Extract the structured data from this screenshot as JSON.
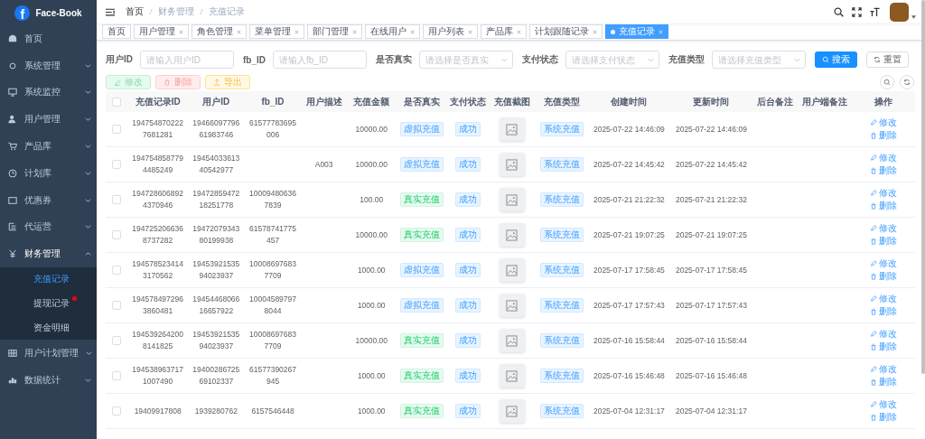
{
  "sidebar": {
    "logo_mark": "f",
    "title": "Face-Book",
    "items": [
      {
        "label": "首页"
      },
      {
        "label": "系统管理",
        "expanded": false
      },
      {
        "label": "系统监控",
        "expanded": false
      },
      {
        "label": "用户管理",
        "expanded": false
      },
      {
        "label": "产品库",
        "expanded": false
      },
      {
        "label": "计划库",
        "expanded": false
      },
      {
        "label": "优惠券",
        "expanded": false
      },
      {
        "label": "代运营",
        "expanded": false
      },
      {
        "label": "财务管理",
        "expanded": true,
        "children": [
          {
            "label": "充值记录",
            "selected": true,
            "dot": false
          },
          {
            "label": "提现记录",
            "selected": false,
            "dot": true
          },
          {
            "label": "资金明细",
            "selected": false,
            "dot": false
          }
        ]
      },
      {
        "label": "用户计划管理",
        "expanded": false
      },
      {
        "label": "数据统计",
        "expanded": false
      }
    ]
  },
  "breadcrumb": [
    "首页",
    "财务管理",
    "充值记录"
  ],
  "tags": [
    {
      "label": "首页",
      "selected": false,
      "closable": false
    },
    {
      "label": "用户管理",
      "selected": false,
      "closable": true
    },
    {
      "label": "角色管理",
      "selected": false,
      "closable": true
    },
    {
      "label": "菜单管理",
      "selected": false,
      "closable": true
    },
    {
      "label": "部门管理",
      "selected": false,
      "closable": true
    },
    {
      "label": "在线用户",
      "selected": false,
      "closable": true
    },
    {
      "label": "用户列表",
      "selected": false,
      "closable": true
    },
    {
      "label": "产品库",
      "selected": false,
      "closable": true
    },
    {
      "label": "计划跟随记录",
      "selected": false,
      "closable": true
    },
    {
      "label": "充值记录",
      "selected": true,
      "closable": true
    }
  ],
  "filters": [
    {
      "label": "用户ID",
      "kind": "input",
      "placeholder": "请输入用户ID"
    },
    {
      "label": "fb_ID",
      "kind": "input",
      "placeholder": "请输入fb_ID"
    },
    {
      "label": "是否真实",
      "kind": "select",
      "placeholder": "请选择是否真实"
    },
    {
      "label": "支付状态",
      "kind": "select",
      "placeholder": "请选择支付状态"
    },
    {
      "label": "充值类型",
      "kind": "select",
      "placeholder": "请选择充值类型"
    }
  ],
  "search_button": "搜索",
  "reset_button": "重置",
  "toolbar": [
    {
      "label": "修改",
      "kind": "edit"
    },
    {
      "label": "删除",
      "kind": "delete"
    },
    {
      "label": "导出",
      "kind": "export"
    }
  ],
  "table": {
    "select_all_checked": false,
    "columns": [
      "充值记录ID",
      "用户ID",
      "fb_ID",
      "用户描述",
      "充值金额",
      "是否真实",
      "支付状态",
      "充值截图",
      "充值类型",
      "创建时间",
      "更新时间",
      "后台备注",
      "用户端备注",
      "操作"
    ],
    "rows": [
      {
        "checked": false,
        "record_id": "1947548702227681281",
        "user_id": "1946609779661983746",
        "fb_id": "61577783695006",
        "amount": "10000.00",
        "real": {
          "text": "虚拟充值",
          "kind": "primary"
        },
        "pay_status": {
          "text": "成功",
          "kind": "primary"
        },
        "type": {
          "text": "系统充值",
          "kind": "primary"
        },
        "created": "2025-07-22 14:46:09",
        "updated": "2025-07-22 14:46:09",
        "actions": [
          "修改",
          "删除"
        ]
      },
      {
        "checked": false,
        "record_id": "1947548587794485249",
        "user_id": "1945403361340542977",
        "description": "A003",
        "amount": "10000.00",
        "real": {
          "text": "虚拟充值",
          "kind": "primary"
        },
        "pay_status": {
          "text": "成功",
          "kind": "primary"
        },
        "type": {
          "text": "系统充值",
          "kind": "primary"
        },
        "created": "2025-07-22 14:45:42",
        "updated": "2025-07-22 14:45:42",
        "actions": [
          "修改",
          "删除"
        ]
      },
      {
        "checked": false,
        "record_id": "1947286068924370946",
        "user_id": "1947285947218251778",
        "fb_id": "100094806367839",
        "amount": "100.00",
        "real": {
          "text": "真实充值",
          "kind": "success"
        },
        "pay_status": {
          "text": "成功",
          "kind": "primary"
        },
        "type": {
          "text": "系统充值",
          "kind": "primary"
        },
        "created": "2025-07-21 21:22:32",
        "updated": "2025-07-21 21:22:32",
        "actions": [
          "修改",
          "删除"
        ]
      },
      {
        "checked": false,
        "record_id": "1947252066368737282",
        "user_id": "1947207934380199938",
        "fb_id": "61578741775457",
        "amount": "10000.00",
        "real": {
          "text": "真实充值",
          "kind": "success"
        },
        "pay_status": {
          "text": "成功",
          "kind": "primary"
        },
        "type": {
          "text": "系统充值",
          "kind": "primary"
        },
        "created": "2025-07-21 19:07:25",
        "updated": "2025-07-21 19:07:25",
        "actions": [
          "修改",
          "删除"
        ]
      },
      {
        "checked": false,
        "record_id": "1945785234143170562",
        "user_id": "1945392153594023937",
        "fb_id": "100086976837709",
        "amount": "1000.00",
        "real": {
          "text": "虚拟充值",
          "kind": "primary"
        },
        "pay_status": {
          "text": "成功",
          "kind": "primary"
        },
        "type": {
          "text": "系统充值",
          "kind": "primary"
        },
        "created": "2025-07-17 17:58:45",
        "updated": "2025-07-17 17:58:45",
        "actions": [
          "修改",
          "删除"
        ]
      },
      {
        "checked": false,
        "record_id": "1945784972963860481",
        "user_id": "1945446806616657922",
        "fb_id": "100045897978044",
        "amount": "1000.00",
        "real": {
          "text": "虚拟充值",
          "kind": "primary"
        },
        "pay_status": {
          "text": "成功",
          "kind": "primary"
        },
        "type": {
          "text": "系统充值",
          "kind": "primary"
        },
        "created": "2025-07-17 17:57:43",
        "updated": "2025-07-17 17:57:43",
        "actions": [
          "修改",
          "删除"
        ]
      },
      {
        "checked": false,
        "record_id": "1945392642008141825",
        "user_id": "1945392153594023937",
        "fb_id": "100086976837709",
        "amount": "10000.00",
        "real": {
          "text": "真实充值",
          "kind": "success"
        },
        "pay_status": {
          "text": "成功",
          "kind": "primary"
        },
        "type": {
          "text": "系统充值",
          "kind": "primary"
        },
        "created": "2025-07-16 15:58:44",
        "updated": "2025-07-16 15:58:44",
        "actions": [
          "修改",
          "删除"
        ]
      },
      {
        "checked": false,
        "record_id": "1945389637171007490",
        "user_id": "1940028672569102337",
        "fb_id": "61577390267945",
        "amount": "1000.00",
        "real": {
          "text": "真实充值",
          "kind": "success"
        },
        "pay_status": {
          "text": "成功",
          "kind": "primary"
        },
        "type": {
          "text": "系统充值",
          "kind": "primary"
        },
        "created": "2025-07-16 15:46:48",
        "updated": "2025-07-16 15:46:48",
        "actions": [
          "修改",
          "删除"
        ]
      },
      {
        "checked": false,
        "record_id": "19409917808",
        "user_id": "1939280762",
        "fb_id": "6157546448",
        "amount": "1000.00",
        "real": {
          "text": "真实充值",
          "kind": "success"
        },
        "pay_status": {
          "text": "成功",
          "kind": "primary"
        },
        "type": {
          "text": "系统充值",
          "kind": "primary"
        },
        "created": "2025-07-04 12:31:17",
        "updated": "2025-07-04 12:31:17",
        "actions": [
          "修改",
          "删除"
        ]
      }
    ]
  }
}
